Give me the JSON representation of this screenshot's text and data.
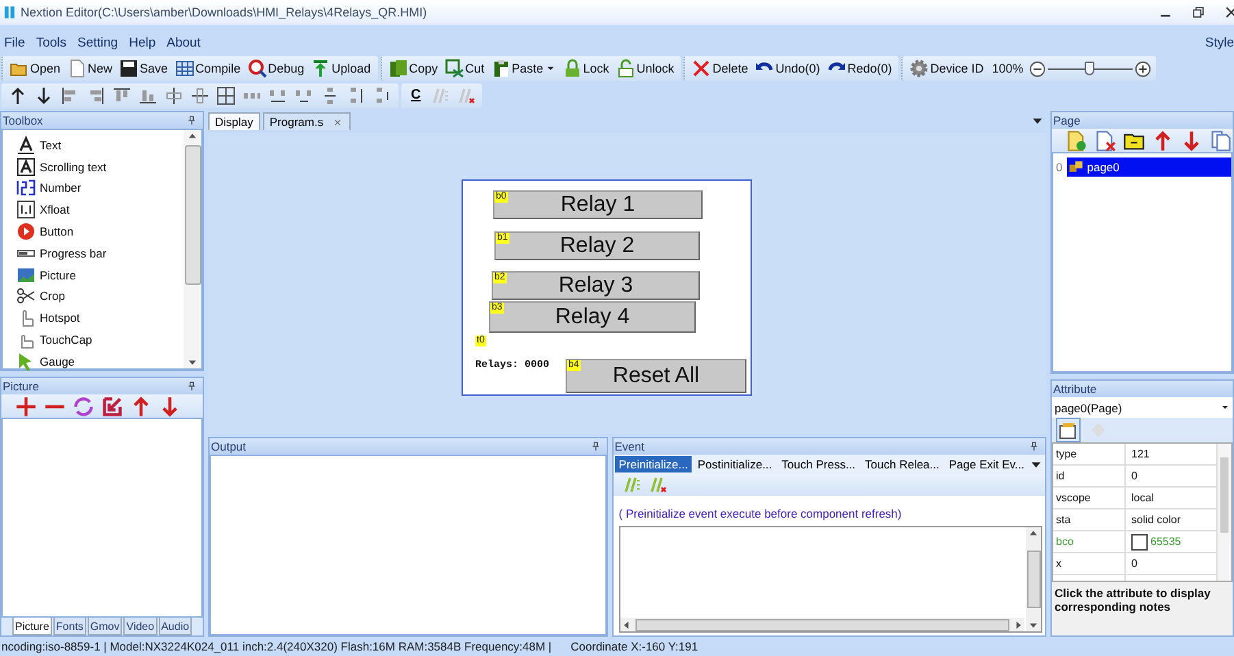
{
  "window": {
    "title": "Nextion Editor(C:\\Users\\amber\\Downloads\\HMI_Relays\\4Relays_QR.HMI)"
  },
  "menu": [
    {
      "label": "File"
    },
    {
      "label": "Tools"
    },
    {
      "label": "Setting"
    },
    {
      "label": "Help"
    },
    {
      "label": "About"
    }
  ],
  "style_menu": "Style",
  "toolbar": {
    "groups": [
      [
        {
          "label": "Open"
        },
        {
          "label": "New"
        },
        {
          "label": "Save"
        },
        {
          "label": "Compile"
        },
        {
          "label": "Debug"
        },
        {
          "label": "Upload"
        }
      ],
      [
        {
          "label": "Copy"
        },
        {
          "label": "Cut"
        },
        {
          "label": "Paste",
          "dropdown": true
        },
        {
          "label": "Lock"
        },
        {
          "label": "Unlock"
        }
      ],
      [
        {
          "label": "Delete"
        },
        {
          "label": "Undo(0)"
        },
        {
          "label": "Redo(0)"
        }
      ],
      [
        {
          "label": "Device ID"
        }
      ]
    ],
    "zoom": {
      "reading": "100%",
      "level": 0.5
    }
  },
  "format_toolbar": {
    "text_button": "C"
  },
  "toolbox": {
    "title": "Toolbox",
    "items": [
      {
        "label": "Text"
      },
      {
        "label": "Scrolling text"
      },
      {
        "label": "Number"
      },
      {
        "label": "Xfloat"
      },
      {
        "label": "Button"
      },
      {
        "label": "Progress bar"
      },
      {
        "label": "Picture"
      },
      {
        "label": "Crop"
      },
      {
        "label": "Hotspot"
      },
      {
        "label": "TouchCap"
      },
      {
        "label": "Gauge"
      }
    ]
  },
  "picture_panel": {
    "title": "Picture",
    "tabs": [
      {
        "label": "Picture",
        "selected": true
      },
      {
        "label": "Fonts",
        "selected": false
      },
      {
        "label": "Gmov",
        "selected": false
      },
      {
        "label": "Video",
        "selected": false
      },
      {
        "label": "Audio",
        "selected": false
      }
    ]
  },
  "display": {
    "tabs": [
      {
        "label": "Display",
        "selected": true,
        "closable": false
      },
      {
        "label": "Program.s",
        "selected": false,
        "closable": true
      }
    ],
    "components": [
      {
        "kind": "button",
        "id": "b0",
        "label": "Relay 1"
      },
      {
        "kind": "button",
        "id": "b1",
        "label": "Relay 2"
      },
      {
        "kind": "button",
        "id": "b2",
        "label": "Relay 3"
      },
      {
        "kind": "button",
        "id": "b3",
        "label": "Relay 4"
      },
      {
        "kind": "text",
        "id": "t0",
        "label": "Relays: 0000"
      },
      {
        "kind": "button",
        "id": "b4",
        "label": "Reset All"
      }
    ]
  },
  "output": {
    "title": "Output"
  },
  "event": {
    "title": "Event",
    "tabs": [
      {
        "label": "Preinitialize...",
        "selected": true
      },
      {
        "label": "Postinitialize...",
        "selected": false
      },
      {
        "label": "Touch Press...",
        "selected": false
      },
      {
        "label": "Touch Relea...",
        "selected": false
      },
      {
        "label": "Page Exit Ev...",
        "selected": false
      }
    ],
    "hint": "( Preinitialize event execute before component refresh)"
  },
  "page_panel": {
    "title": "Page",
    "pages": [
      {
        "index": "0",
        "name": "page0",
        "selected": true
      }
    ]
  },
  "attribute": {
    "title": "Attribute",
    "object": "page0(Page)",
    "rows": [
      {
        "name": "type",
        "value": "121",
        "kind": "plain"
      },
      {
        "name": "id",
        "value": "0",
        "kind": "plain"
      },
      {
        "name": "vscope",
        "value": "local",
        "kind": "plain"
      },
      {
        "name": "sta",
        "value": "solid color",
        "kind": "plain"
      },
      {
        "name": "bco",
        "value": "65535",
        "kind": "color"
      },
      {
        "name": "x",
        "value": "0",
        "kind": "plain"
      }
    ],
    "note": "Click the attribute to display corresponding notes"
  },
  "status_bar": {
    "info": "ncoding:iso-8859-1 | Model:NX3224K024_011 inch:2.4(240X320) Flash:16M RAM:3584B Frequency:48M |",
    "coordinate": "Coordinate X:-160  Y:191"
  }
}
